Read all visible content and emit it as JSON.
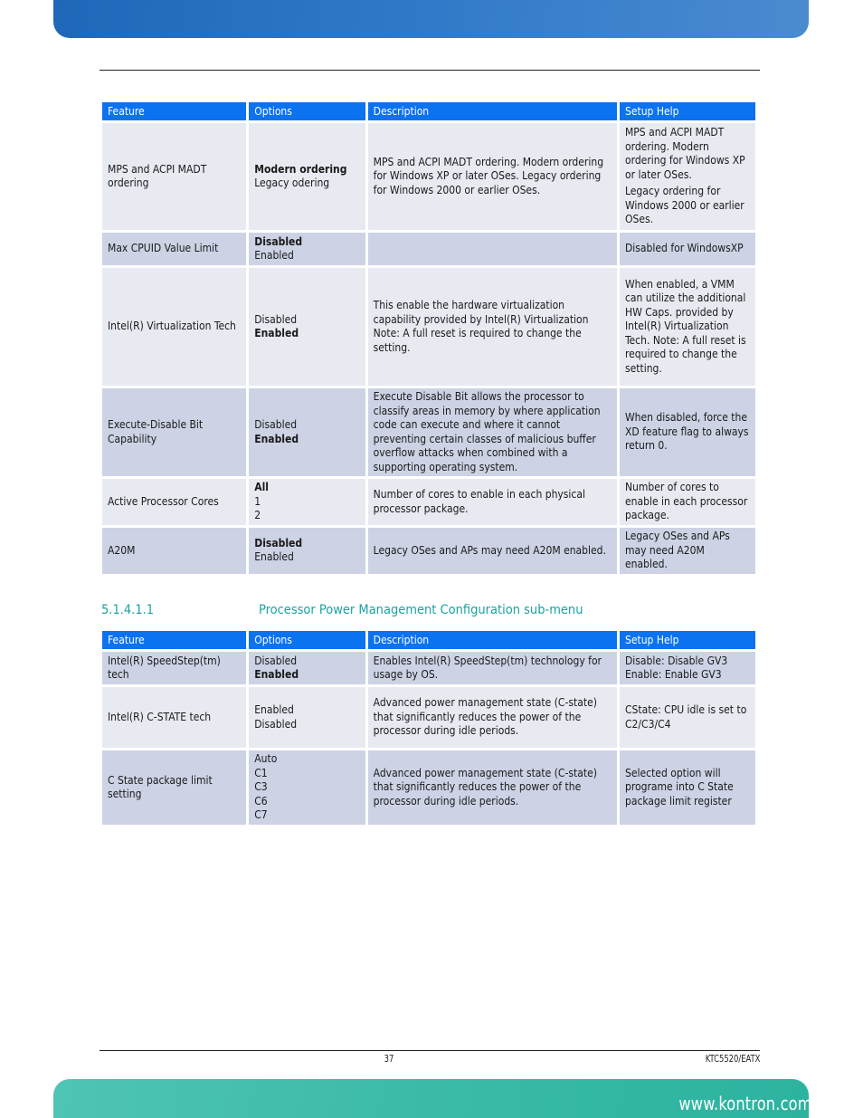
{
  "header": {},
  "table1": {
    "columns": [
      "Feature",
      "Options",
      "Description",
      "Setup Help"
    ],
    "rows": [
      {
        "feature": "MPS and ACPI MADT ordering",
        "options": [
          {
            "label": "Modern ordering",
            "selected": true
          },
          {
            "label": "Legacy odering",
            "selected": false
          }
        ],
        "description": "MPS and ACPI MADT ordering. Modern ordering for Windows XP or later OSes. Legacy ordering for Windows 2000 or  earlier OSes.",
        "help": [
          "MPS and ACPI MADT ordering. Modern ordering for Windows XP or later OSes.",
          "Legacy ordering for Windows 2000 or earlier OSes."
        ]
      },
      {
        "feature": "Max CPUID Value Limit",
        "options": [
          {
            "label": "Disabled",
            "selected": true
          },
          {
            "label": "Enabled",
            "selected": false
          }
        ],
        "description": "",
        "help": [
          "Disabled for WindowsXP"
        ]
      },
      {
        "feature": "Intel(R) Virtualization Tech",
        "options": [
          {
            "label": "Disabled",
            "selected": false
          },
          {
            "label": "Enabled",
            "selected": true
          }
        ],
        "description": "This enable the hardware virtualization capability provided by Intel(R) Virtualization Note: A full reset is required to change the setting.",
        "help": [
          "When enabled, a VMM can utilize the additional HW Caps. provided by Intel(R) Virtualization Tech. Note: A full reset is required to change the setting."
        ]
      },
      {
        "feature": "Execute-Disable Bit Capability",
        "options": [
          {
            "label": "Disabled",
            "selected": false
          },
          {
            "label": "Enabled",
            "selected": true
          }
        ],
        "description": "Execute Disable Bit allows the processor to classify areas in memory by where application code can execute and where it cannot preventing certain classes of malicious buffer overflow attacks when combined with a supporting operating system.",
        "help": [
          "When disabled, force the XD feature flag to always return 0."
        ]
      },
      {
        "feature": "Active Processor Cores",
        "options": [
          {
            "label": "All",
            "selected": true
          },
          {
            "label": "1",
            "selected": false
          },
          {
            "label": "2",
            "selected": false
          }
        ],
        "description": "Number of cores to enable in each physical processor package.",
        "help": [
          "Number of cores to enable in each processor package."
        ]
      },
      {
        "feature": "A20M",
        "options": [
          {
            "label": "Disabled",
            "selected": true
          },
          {
            "label": "Enabled",
            "selected": false
          }
        ],
        "description": "Legacy OSes and APs may need A20M enabled.",
        "help": [
          "Legacy OSes and APs may need A20M enabled."
        ]
      }
    ]
  },
  "section": {
    "number": "5.1.4.1.1",
    "title": "Processor Power Management Configuration sub-menu"
  },
  "table2": {
    "columns": [
      "Feature",
      "Options",
      "Description",
      "Setup Help"
    ],
    "rows": [
      {
        "feature": "Intel(R) SpeedStep(tm) tech",
        "options": [
          {
            "label": "Disabled",
            "selected": false
          },
          {
            "label": "Enabled",
            "selected": true
          }
        ],
        "description": "Enables Intel(R) SpeedStep(tm) technology for usage by OS.",
        "help": [
          "Disable: Disable GV3 Enable:  Enable GV3"
        ]
      },
      {
        "feature": "Intel(R) C-STATE tech",
        "options": [
          {
            "label": "Enabled",
            "selected": false
          },
          {
            "label": "Disabled",
            "selected": false
          }
        ],
        "description": "Advanced power management state (C-state) that significantly reduces the power of the processor during idle periods.",
        "help": [
          "CState: CPU idle is set to C2/C3/C4"
        ]
      },
      {
        "feature": "C State package limit setting",
        "options": [
          {
            "label": "Auto",
            "selected": false
          },
          {
            "label": "C1",
            "selected": false
          },
          {
            "label": "C3",
            "selected": false
          },
          {
            "label": "C6",
            "selected": false
          },
          {
            "label": "C7",
            "selected": false
          }
        ],
        "description": "Advanced power management state (C-state) that significantly reduces the power of the processor during idle periods.",
        "help": [
          "Selected option will programe into C State package limit register"
        ]
      }
    ]
  },
  "footer": {
    "page_number": "37",
    "doc_id": "KTC5520/EATX",
    "website": "www.kontron.com"
  },
  "colors": {
    "header_blue": "#0b72f0",
    "row_light": "#e7eaf1",
    "row_dark": "#cdd3e5",
    "section_teal": "#1aa3a0",
    "top_banner": "#2f78c8",
    "bottom_banner": "#3bbaa9"
  }
}
